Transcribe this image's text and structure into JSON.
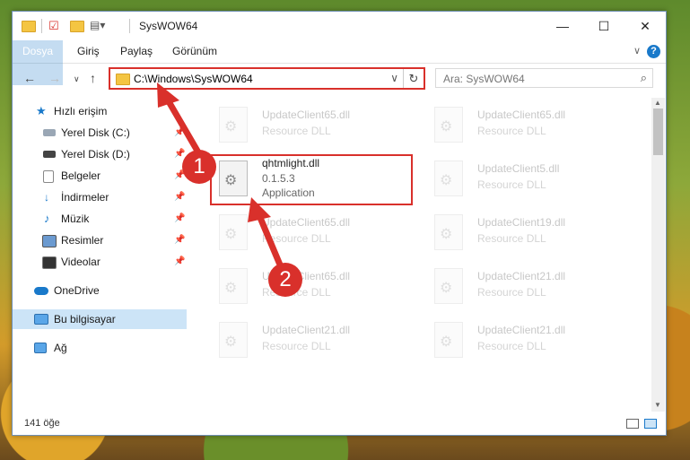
{
  "window": {
    "title": "SysWOW64",
    "controls": {
      "minimize": "—",
      "maximize": "☐",
      "close": "✕"
    }
  },
  "ribbon": {
    "tabs": [
      "Dosya",
      "Giriş",
      "Paylaş",
      "Görünüm"
    ],
    "help": "?"
  },
  "nav": {
    "address": "C:\\Windows\\SysWOW64",
    "search_placeholder": "Ara: SysWOW64"
  },
  "sidebar": {
    "items": [
      {
        "label": "Hızlı erişim",
        "icon": "star-icon"
      },
      {
        "label": "Yerel Disk (C:)",
        "icon": "drive-icon",
        "pinned": true
      },
      {
        "label": "Yerel Disk (D:)",
        "icon": "drive-icon",
        "pinned": true
      },
      {
        "label": "Belgeler",
        "icon": "documents-icon",
        "pinned": true
      },
      {
        "label": "İndirmeler",
        "icon": "download-icon",
        "pinned": true
      },
      {
        "label": "Müzik",
        "icon": "music-icon",
        "pinned": true
      },
      {
        "label": "Resimler",
        "icon": "pictures-icon",
        "pinned": true
      },
      {
        "label": "Videolar",
        "icon": "videos-icon",
        "pinned": true
      },
      {
        "label": "OneDrive",
        "icon": "cloud-icon"
      },
      {
        "label": "Bu bilgisayar",
        "icon": "computer-icon",
        "selected": true
      },
      {
        "label": "Ağ",
        "icon": "network-icon"
      }
    ]
  },
  "files": [
    {
      "name": "UpdateClient65.dll",
      "desc": "Resource DLL"
    },
    {
      "name": "UpdateClient65.dll",
      "desc": "Resource DLL"
    },
    {
      "name": "qhtmlight.dll",
      "version": "0.1.5.3",
      "desc": "Application"
    },
    {
      "name": "UpdateClient5.dll",
      "desc": "Resource DLL"
    },
    {
      "name": "UpdateClient65.dll",
      "desc": "Resource DLL"
    },
    {
      "name": "UpdateClient19.dll",
      "desc": "Resource DLL"
    },
    {
      "name": "UpdateClient65.dll",
      "desc": "Resource DLL"
    },
    {
      "name": "UpdateClient21.dll",
      "desc": "Resource DLL"
    },
    {
      "name": "UpdateClient21.dll",
      "desc": "Resource DLL"
    },
    {
      "name": "UpdateClient21.dll",
      "desc": "Resource DLL"
    }
  ],
  "status": {
    "count": "141 öğe"
  },
  "callouts": [
    "1",
    "2"
  ],
  "colors": {
    "accent": "#1979ca",
    "highlight": "#d9302b",
    "selected": "#cce4f7"
  }
}
